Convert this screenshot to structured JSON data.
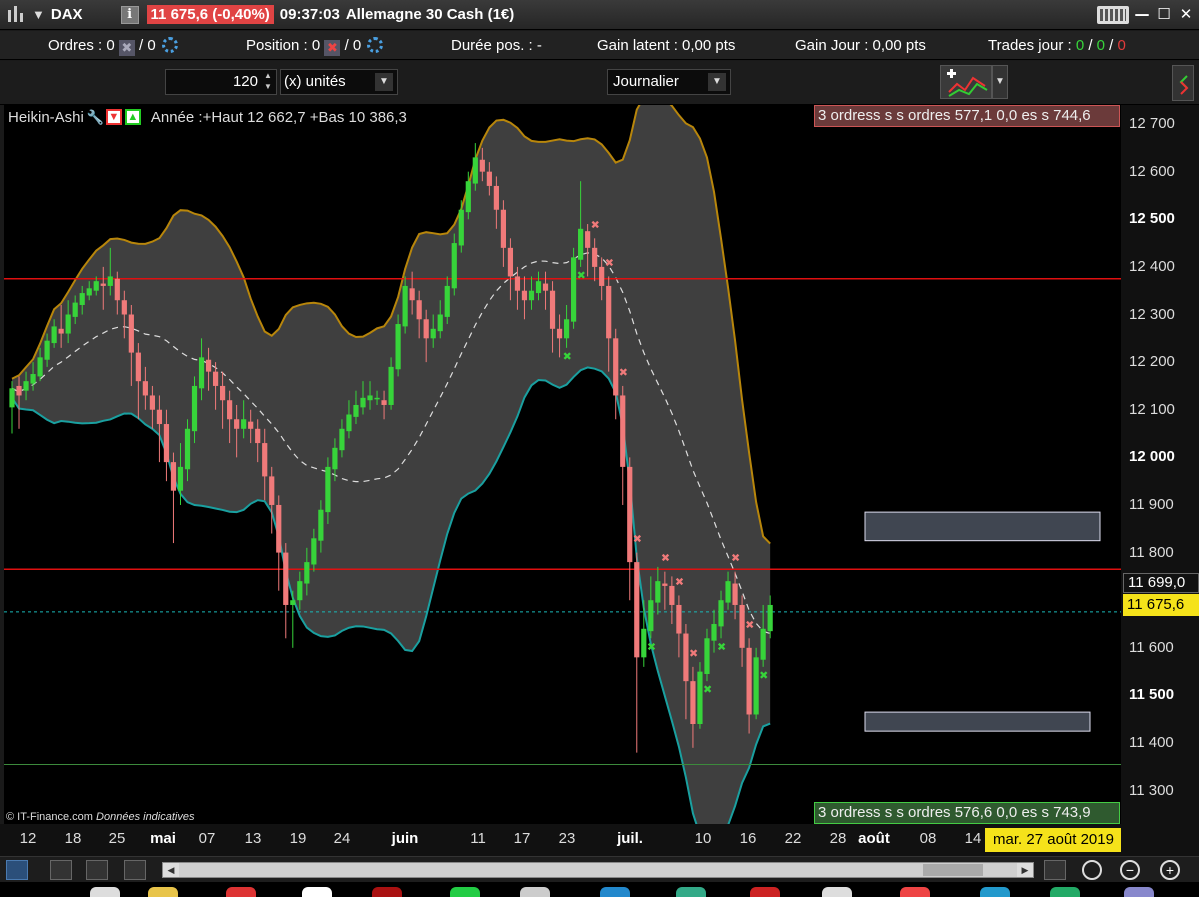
{
  "titlebar": {
    "symbol": "DAX",
    "price_change": "11 675,6 (-0,40%)",
    "time": "09:37:03",
    "instrument": "Allemagne 30 Cash (1€)",
    "info_icon": "i",
    "minimize": "—",
    "maximize": "☐",
    "close": "✕"
  },
  "stats": {
    "orders_label": "Ordres : ",
    "orders_value": "0",
    "orders_value2": "/ 0",
    "position_label": "Position : ",
    "position_value": "0",
    "position_value2": "/ 0",
    "duration_label": "Durée pos. : -",
    "gain_latent": "Gain latent : 0,00 pts",
    "gain_jour": "Gain Jour : 0,00 pts",
    "trades_label": "Trades jour : ",
    "trades_a": "0",
    "trades_sep1": " / ",
    "trades_b": "0",
    "trades_sep2": " / ",
    "trades_c": "0"
  },
  "toolbar": {
    "units_value": "120",
    "units_label": "(x) unités",
    "period": "Journalier"
  },
  "legend": {
    "chart_type": "Heikin-Ashi",
    "stats": "Année :+Haut 12 662,7 +Bas 10 386,3"
  },
  "orders_top": "3 ordress s s ordres 577,1 0,0 es s 744,6",
  "orders_bottom": "3 ordress s s ordres 576,6 0,0 es s 743,9",
  "copyright_a": "© IT-Finance.com",
  "copyright_b": "Données indicatives",
  "price_axis": [
    {
      "label": "12 700",
      "bold": false
    },
    {
      "label": "12 600",
      "bold": false
    },
    {
      "label": "12 500",
      "bold": true
    },
    {
      "label": "12 400",
      "bold": false
    },
    {
      "label": "12 300",
      "bold": false
    },
    {
      "label": "12 200",
      "bold": false
    },
    {
      "label": "12 100",
      "bold": false
    },
    {
      "label": "12 000",
      "bold": true
    },
    {
      "label": "11 900",
      "bold": false
    },
    {
      "label": "11 800",
      "bold": false
    },
    {
      "label": "11 600",
      "bold": false
    },
    {
      "label": "11 500",
      "bold": true
    },
    {
      "label": "11 400",
      "bold": false
    },
    {
      "label": "11 300",
      "bold": false
    }
  ],
  "last_ref_price": "11 699,0",
  "current_price": "11 675,6",
  "time_axis": [
    {
      "label": "12",
      "bold": false
    },
    {
      "label": "18",
      "bold": false
    },
    {
      "label": "25",
      "bold": false
    },
    {
      "label": "mai",
      "bold": true
    },
    {
      "label": "07",
      "bold": false
    },
    {
      "label": "13",
      "bold": false
    },
    {
      "label": "19",
      "bold": false
    },
    {
      "label": "24",
      "bold": false
    },
    {
      "label": "juin",
      "bold": true
    },
    {
      "label": "11",
      "bold": false
    },
    {
      "label": "17",
      "bold": false
    },
    {
      "label": "23",
      "bold": false
    },
    {
      "label": "juil.",
      "bold": true
    },
    {
      "label": "10",
      "bold": false
    },
    {
      "label": "16",
      "bold": false
    },
    {
      "label": "22",
      "bold": false
    },
    {
      "label": "28",
      "bold": false
    },
    {
      "label": "août",
      "bold": true
    },
    {
      "label": "08",
      "bold": false
    },
    {
      "label": "14",
      "bold": false
    }
  ],
  "date_cursor": "mar. 27 août 2019",
  "colors": {
    "up": "#37d43a",
    "down": "#f07a7a",
    "band_fill": "#4a4a4a",
    "upper_band": "#b8860b",
    "lower_band": "#1aa0a0",
    "resistance": "#e01010",
    "current": "#1ab8b8"
  },
  "icons": [
    "chart-type-icon",
    "info-icon",
    "keyboard-icon",
    "gear-icon",
    "wrench-icon",
    "sell-icon",
    "buy-icon",
    "indicator-icon",
    "zoom-in-icon",
    "zoom-out-icon",
    "search-icon"
  ],
  "chart_data": {
    "type": "candlestick",
    "style": "Heikin-Ashi",
    "ylim": [
      11230,
      12740
    ],
    "horizontal_lines": [
      12375,
      11765,
      11355
    ],
    "current_price": 11675.6,
    "candles": [
      {
        "o": 12105,
        "c": 12145,
        "h": 12160,
        "l": 12050
      },
      {
        "o": 12150,
        "c": 12130,
        "h": 12170,
        "l": 12060
      },
      {
        "o": 12140,
        "c": 12160,
        "h": 12180,
        "l": 12120
      },
      {
        "o": 12155,
        "c": 12175,
        "h": 12200,
        "l": 12140
      },
      {
        "o": 12170,
        "c": 12210,
        "h": 12230,
        "l": 12160
      },
      {
        "o": 12205,
        "c": 12245,
        "h": 12260,
        "l": 12190
      },
      {
        "o": 12240,
        "c": 12275,
        "h": 12290,
        "l": 12230
      },
      {
        "o": 12270,
        "c": 12260,
        "h": 12320,
        "l": 12230
      },
      {
        "o": 12260,
        "c": 12300,
        "h": 12330,
        "l": 12240
      },
      {
        "o": 12295,
        "c": 12325,
        "h": 12340,
        "l": 12280
      },
      {
        "o": 12320,
        "c": 12345,
        "h": 12360,
        "l": 12300
      },
      {
        "o": 12340,
        "c": 12355,
        "h": 12370,
        "l": 12330
      },
      {
        "o": 12350,
        "c": 12370,
        "h": 12380,
        "l": 12340
      },
      {
        "o": 12365,
        "c": 12360,
        "h": 12400,
        "l": 12310
      },
      {
        "o": 12360,
        "c": 12380,
        "h": 12440,
        "l": 12340
      },
      {
        "o": 12375,
        "c": 12330,
        "h": 12390,
        "l": 12300
      },
      {
        "o": 12330,
        "c": 12300,
        "h": 12350,
        "l": 12250
      },
      {
        "o": 12300,
        "c": 12220,
        "h": 12320,
        "l": 12150
      },
      {
        "o": 12220,
        "c": 12160,
        "h": 12240,
        "l": 12080
      },
      {
        "o": 12160,
        "c": 12130,
        "h": 12190,
        "l": 12100
      },
      {
        "o": 12130,
        "c": 12100,
        "h": 12150,
        "l": 12060
      },
      {
        "o": 12100,
        "c": 12070,
        "h": 12130,
        "l": 11990
      },
      {
        "o": 12070,
        "c": 11990,
        "h": 12100,
        "l": 11950
      },
      {
        "o": 11990,
        "c": 11930,
        "h": 12010,
        "l": 11820
      },
      {
        "o": 11930,
        "c": 11980,
        "h": 12030,
        "l": 11900
      },
      {
        "o": 11975,
        "c": 12060,
        "h": 12080,
        "l": 11950
      },
      {
        "o": 12055,
        "c": 12150,
        "h": 12170,
        "l": 12030
      },
      {
        "o": 12145,
        "c": 12210,
        "h": 12250,
        "l": 12120
      },
      {
        "o": 12205,
        "c": 12180,
        "h": 12230,
        "l": 12140
      },
      {
        "o": 12180,
        "c": 12150,
        "h": 12200,
        "l": 12100
      },
      {
        "o": 12150,
        "c": 12120,
        "h": 12180,
        "l": 12060
      },
      {
        "o": 12120,
        "c": 12080,
        "h": 12140,
        "l": 12030
      },
      {
        "o": 12080,
        "c": 12060,
        "h": 12110,
        "l": 12000
      },
      {
        "o": 12060,
        "c": 12080,
        "h": 12120,
        "l": 12040
      },
      {
        "o": 12075,
        "c": 12060,
        "h": 12100,
        "l": 12030
      },
      {
        "o": 12060,
        "c": 12030,
        "h": 12080,
        "l": 11990
      },
      {
        "o": 12030,
        "c": 11960,
        "h": 12060,
        "l": 11910
      },
      {
        "o": 11960,
        "c": 11900,
        "h": 11980,
        "l": 11840
      },
      {
        "o": 11900,
        "c": 11800,
        "h": 11920,
        "l": 11720
      },
      {
        "o": 11800,
        "c": 11690,
        "h": 11820,
        "l": 11620
      },
      {
        "o": 11690,
        "c": 11700,
        "h": 11720,
        "l": 11600
      },
      {
        "o": 11700,
        "c": 11740,
        "h": 11760,
        "l": 11680
      },
      {
        "o": 11735,
        "c": 11780,
        "h": 11810,
        "l": 11710
      },
      {
        "o": 11775,
        "c": 11830,
        "h": 11850,
        "l": 11760
      },
      {
        "o": 11825,
        "c": 11890,
        "h": 11910,
        "l": 11800
      },
      {
        "o": 11885,
        "c": 11980,
        "h": 12000,
        "l": 11860
      },
      {
        "o": 11975,
        "c": 12020,
        "h": 12040,
        "l": 11950
      },
      {
        "o": 12015,
        "c": 12060,
        "h": 12080,
        "l": 12000
      },
      {
        "o": 12055,
        "c": 12090,
        "h": 12120,
        "l": 12040
      },
      {
        "o": 12085,
        "c": 12110,
        "h": 12140,
        "l": 12070
      },
      {
        "o": 12105,
        "c": 12125,
        "h": 12160,
        "l": 12090
      },
      {
        "o": 12120,
        "c": 12130,
        "h": 12160,
        "l": 12100
      },
      {
        "o": 12125,
        "c": 12125,
        "h": 12140,
        "l": 12110
      },
      {
        "o": 12120,
        "c": 12110,
        "h": 12140,
        "l": 12080
      },
      {
        "o": 12110,
        "c": 12190,
        "h": 12210,
        "l": 12100
      },
      {
        "o": 12185,
        "c": 12280,
        "h": 12300,
        "l": 12170
      },
      {
        "o": 12275,
        "c": 12360,
        "h": 12380,
        "l": 12260
      },
      {
        "o": 12355,
        "c": 12330,
        "h": 12390,
        "l": 12300
      },
      {
        "o": 12330,
        "c": 12290,
        "h": 12350,
        "l": 12250
      },
      {
        "o": 12290,
        "c": 12250,
        "h": 12310,
        "l": 12200
      },
      {
        "o": 12250,
        "c": 12270,
        "h": 12300,
        "l": 12230
      },
      {
        "o": 12265,
        "c": 12300,
        "h": 12330,
        "l": 12250
      },
      {
        "o": 12295,
        "c": 12360,
        "h": 12380,
        "l": 12280
      },
      {
        "o": 12355,
        "c": 12450,
        "h": 12470,
        "l": 12340
      },
      {
        "o": 12445,
        "c": 12520,
        "h": 12540,
        "l": 12430
      },
      {
        "o": 12515,
        "c": 12580,
        "h": 12600,
        "l": 12500
      },
      {
        "o": 12575,
        "c": 12630,
        "h": 12660,
        "l": 12560
      },
      {
        "o": 12625,
        "c": 12600,
        "h": 12650,
        "l": 12580
      },
      {
        "o": 12600,
        "c": 12570,
        "h": 12620,
        "l": 12550
      },
      {
        "o": 12570,
        "c": 12520,
        "h": 12590,
        "l": 12480
      },
      {
        "o": 12520,
        "c": 12440,
        "h": 12540,
        "l": 12400
      },
      {
        "o": 12440,
        "c": 12380,
        "h": 12460,
        "l": 12330
      },
      {
        "o": 12380,
        "c": 12350,
        "h": 12400,
        "l": 12310
      },
      {
        "o": 12350,
        "c": 12330,
        "h": 12380,
        "l": 12290
      },
      {
        "o": 12330,
        "c": 12350,
        "h": 12380,
        "l": 12310
      },
      {
        "o": 12345,
        "c": 12370,
        "h": 12390,
        "l": 12330
      },
      {
        "o": 12365,
        "c": 12350,
        "h": 12390,
        "l": 12310
      },
      {
        "o": 12350,
        "c": 12270,
        "h": 12370,
        "l": 12220
      },
      {
        "o": 12270,
        "c": 12250,
        "h": 12300,
        "l": 12210
      },
      {
        "o": 12250,
        "c": 12290,
        "h": 12320,
        "l": 12230
      },
      {
        "o": 12285,
        "c": 12420,
        "h": 12440,
        "l": 12270
      },
      {
        "o": 12415,
        "c": 12480,
        "h": 12580,
        "l": 12400
      },
      {
        "o": 12475,
        "c": 12440,
        "h": 12490,
        "l": 12380
      },
      {
        "o": 12440,
        "c": 12400,
        "h": 12460,
        "l": 12370
      },
      {
        "o": 12400,
        "c": 12360,
        "h": 12420,
        "l": 12330
      },
      {
        "o": 12360,
        "c": 12250,
        "h": 12380,
        "l": 12180
      },
      {
        "o": 12250,
        "c": 12130,
        "h": 12270,
        "l": 12080
      },
      {
        "o": 12130,
        "c": 11980,
        "h": 12150,
        "l": 11900
      },
      {
        "o": 11980,
        "c": 11780,
        "h": 12000,
        "l": 11700
      },
      {
        "o": 11780,
        "c": 11580,
        "h": 11800,
        "l": 11380
      },
      {
        "o": 11580,
        "c": 11640,
        "h": 11700,
        "l": 11560
      },
      {
        "o": 11635,
        "c": 11700,
        "h": 11750,
        "l": 11620
      },
      {
        "o": 11695,
        "c": 11740,
        "h": 11770,
        "l": 11670
      },
      {
        "o": 11735,
        "c": 11730,
        "h": 11760,
        "l": 11680
      },
      {
        "o": 11730,
        "c": 11690,
        "h": 11750,
        "l": 11650
      },
      {
        "o": 11690,
        "c": 11630,
        "h": 11710,
        "l": 11580
      },
      {
        "o": 11630,
        "c": 11530,
        "h": 11650,
        "l": 11450
      },
      {
        "o": 11530,
        "c": 11440,
        "h": 11560,
        "l": 11390
      },
      {
        "o": 11440,
        "c": 11550,
        "h": 11570,
        "l": 11430
      },
      {
        "o": 11545,
        "c": 11620,
        "h": 11640,
        "l": 11530
      },
      {
        "o": 11615,
        "c": 11650,
        "h": 11680,
        "l": 11590
      },
      {
        "o": 11645,
        "c": 11700,
        "h": 11720,
        "l": 11620
      },
      {
        "o": 11695,
        "c": 11740,
        "h": 11760,
        "l": 11680
      },
      {
        "o": 11735,
        "c": 11690,
        "h": 11760,
        "l": 11660
      },
      {
        "o": 11690,
        "c": 11600,
        "h": 11710,
        "l": 11560
      },
      {
        "o": 11600,
        "c": 11460,
        "h": 11620,
        "l": 11420
      },
      {
        "o": 11460,
        "c": 11580,
        "h": 11600,
        "l": 11450
      },
      {
        "o": 11575,
        "c": 11640,
        "h": 11690,
        "l": 11560
      },
      {
        "o": 11635,
        "c": 11690,
        "h": 11710,
        "l": 11620
      }
    ]
  }
}
